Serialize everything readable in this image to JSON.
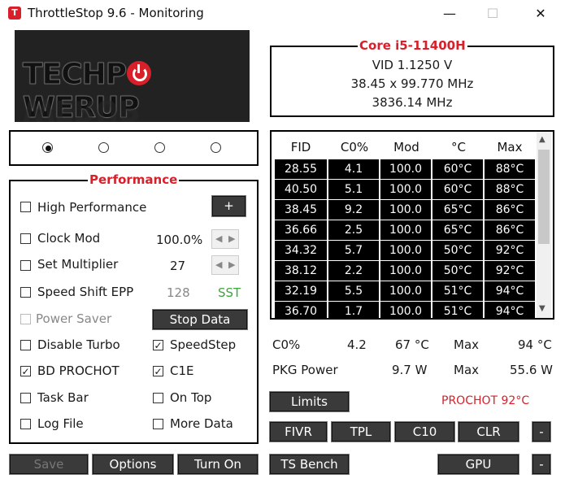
{
  "window": {
    "title": "ThrottleStop 9.6 - Monitoring",
    "app_icon": "T",
    "minimize": "—",
    "maximize": "☐",
    "close": "✕"
  },
  "logo": {
    "text": "TECHPOWERUP",
    "part1": "TECHP",
    "part2": "WERUP"
  },
  "cpu": {
    "title": "Core i5-11400H",
    "vid": "VID  1.1250 V",
    "multiplier": "38.45 x 99.770 MHz",
    "freq": "3836.14 MHz"
  },
  "profiles": [
    {
      "selected": true
    },
    {
      "selected": false
    },
    {
      "selected": false
    },
    {
      "selected": false
    }
  ],
  "performance": {
    "title": "Performance",
    "high_performance": "High Performance",
    "plus": "+",
    "clock_mod": "Clock Mod",
    "clock_mod_value": "100.0%",
    "set_multiplier": "Set Multiplier",
    "set_multiplier_value": "27",
    "speed_shift": "Speed Shift EPP",
    "speed_shift_value": "128",
    "sst": "SST",
    "power_saver": "Power Saver",
    "stop_data": "Stop Data",
    "disable_turbo": "Disable Turbo",
    "speedstep": "SpeedStep",
    "bd_prochot": "BD PROCHOT",
    "c1e": "C1E",
    "task_bar": "Task Bar",
    "on_top": "On Top",
    "log_file": "Log File",
    "more_data": "More Data",
    "check": "✓"
  },
  "table": {
    "headers": [
      "FID",
      "C0%",
      "Mod",
      "°C",
      "Max"
    ],
    "rows": [
      [
        "28.55",
        "4.1",
        "100.0",
        "60°C",
        "88°C"
      ],
      [
        "40.50",
        "5.1",
        "100.0",
        "60°C",
        "88°C"
      ],
      [
        "38.45",
        "9.2",
        "100.0",
        "65°C",
        "86°C"
      ],
      [
        "36.66",
        "2.5",
        "100.0",
        "65°C",
        "86°C"
      ],
      [
        "34.32",
        "5.7",
        "100.0",
        "50°C",
        "92°C"
      ],
      [
        "38.12",
        "2.2",
        "100.0",
        "50°C",
        "92°C"
      ],
      [
        "32.19",
        "5.5",
        "100.0",
        "51°C",
        "94°C"
      ],
      [
        "36.70",
        "1.7",
        "100.0",
        "51°C",
        "94°C"
      ]
    ],
    "scroll_up": "▲",
    "scroll_down": "▼"
  },
  "stats": {
    "c0_label": "C0%",
    "c0_value": "4.2",
    "temp": "67 °C",
    "max_label": "Max",
    "max_temp": "94 °C",
    "pkg_label": "PKG Power",
    "pkg_value": "9.7 W",
    "pkg_max_label": "Max",
    "pkg_max": "55.6 W"
  },
  "buttons": {
    "limits": "Limits",
    "prochot": "PROCHOT 92°C",
    "fivr": "FIVR",
    "tpl": "TPL",
    "c10": "C10",
    "clr": "CLR",
    "dash1": "-",
    "save": "Save",
    "options": "Options",
    "turn_on": "Turn On",
    "ts_bench": "TS Bench",
    "gpu": "GPU",
    "dash2": "-"
  }
}
